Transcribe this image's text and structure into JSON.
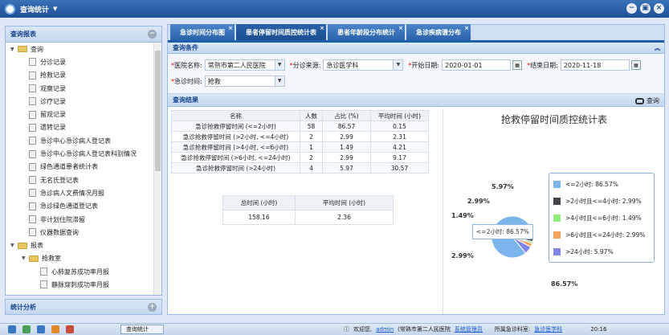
{
  "app": {
    "title": "查询统计",
    "window_buttons": [
      "minimize",
      "restore",
      "close"
    ]
  },
  "left": {
    "panel_title": "查询报表",
    "collapse": "−",
    "tree": [
      {
        "label": "查询",
        "level": 0,
        "type": "folder",
        "expanded": true
      },
      {
        "label": "分诊记录",
        "level": 1,
        "type": "file"
      },
      {
        "label": "抢救记录",
        "level": 1,
        "type": "file"
      },
      {
        "label": "观察记录",
        "level": 1,
        "type": "file"
      },
      {
        "label": "诊疗记录",
        "level": 1,
        "type": "file"
      },
      {
        "label": "留观记录",
        "level": 1,
        "type": "file"
      },
      {
        "label": "遗转记录",
        "level": 1,
        "type": "file"
      },
      {
        "label": "急诊中心急诊病人登记表",
        "level": 1,
        "type": "file"
      },
      {
        "label": "急诊中心急诊病人登记表科别情况",
        "level": 1,
        "type": "file"
      },
      {
        "label": "绿色通道患者统计表",
        "level": 1,
        "type": "file"
      },
      {
        "label": "无名氏登记表",
        "level": 1,
        "type": "file"
      },
      {
        "label": "急诊病人文费情况月报",
        "level": 1,
        "type": "file"
      },
      {
        "label": "急诊绿色通道登记表",
        "level": 1,
        "type": "file"
      },
      {
        "label": "非计划住院滞留",
        "level": 1,
        "type": "file"
      },
      {
        "label": "仪器数据查询",
        "level": 1,
        "type": "file"
      },
      {
        "label": "报表",
        "level": 0,
        "type": "folder",
        "expanded": true
      },
      {
        "label": "抢救室",
        "level": 1,
        "type": "folder",
        "expanded": true
      },
      {
        "label": "心肺复苏成功率月报",
        "level": 2,
        "type": "file"
      },
      {
        "label": "静脉穿刺成功率月报",
        "level": 2,
        "type": "file"
      }
    ],
    "bottom_panel_title": "统计分析",
    "expand": "+"
  },
  "tabs": [
    {
      "label": "急诊时间分布图",
      "active": false
    },
    {
      "label": "患者停留时间质控统计表",
      "active": true
    },
    {
      "label": "患者年龄段分布统计",
      "active": false
    },
    {
      "label": "急诊疾病谱分布",
      "active": false
    }
  ],
  "filters": {
    "section_title": "查询条件",
    "hospital_label": "医院名称:",
    "hospital_value": "常熟市第二人民医院",
    "source_label": "分诊来源:",
    "source_value": "急诊医学科",
    "start_label": "开始日期:",
    "start_value": "2020-01-01",
    "end_label": "结束日期:",
    "end_value": "2020-11-18",
    "time_label": "急诊时间:",
    "time_value": "抢救",
    "required_mark": "*"
  },
  "results": {
    "section_title": "查询结果",
    "query_label": "查询",
    "table": {
      "headers": [
        "名称",
        "人数",
        "占比 (%)",
        "平均时间 (小时)"
      ],
      "rows": [
        [
          "急诊抢救停留时间 (<=2小时)",
          "58",
          "86.57",
          "0.15"
        ],
        [
          "急诊抢救停留时间 (>2小时, <=4小时)",
          "2",
          "2.99",
          "2.31"
        ],
        [
          "急诊抢救停留时间 (>4小时, <=6小时)",
          "1",
          "1.49",
          "4.21"
        ],
        [
          "急诊抢救停留时间 (>6小时, <=24小时)",
          "2",
          "2.99",
          "9.17"
        ],
        [
          "急诊抢救停留时间 (>24小时)",
          "4",
          "5.97",
          "30.57"
        ]
      ]
    },
    "summary": {
      "headers": [
        "总时间 (小时)",
        "平均时间 (小时)"
      ],
      "values": [
        "158.16",
        "2.36"
      ]
    }
  },
  "chart_data": {
    "type": "pie",
    "title": "抢救停留时间质控统计表",
    "categories": [
      "<=2小时",
      "<2小时且<=4小时",
      "<4小时且<=6小时",
      "<6小时且<=24小时",
      ">24小时"
    ],
    "values": [
      86.57,
      2.99,
      1.49,
      2.99,
      5.97
    ],
    "colors": [
      "#7cb5ec",
      "#434348",
      "#90ed7d",
      "#f7a35c",
      "#8085e9"
    ],
    "legend_labels": [
      "<=2小时: 86.57%",
      ">2小时且<=4小时: 2.99%",
      ">4小时且<=6小时: 1.49%",
      ">6小时且<=24小时: 2.99%",
      ">24小时: 5.97%"
    ],
    "data_labels": [
      "86.57%",
      "2.99%",
      "1.49%",
      "2.99%",
      "5.97%"
    ],
    "tooltip": "<=2小时: 86.57%",
    "legend_position": "right"
  },
  "taskbar": {
    "task_label": "查询统计",
    "welcome": "欢迎您,",
    "user": "admin",
    "org": "(常熟市第二人民医院",
    "role": "系统管理员",
    "dept_label": "所属急诊科室:",
    "dept": "急诊医学科",
    "time": "20:16"
  }
}
